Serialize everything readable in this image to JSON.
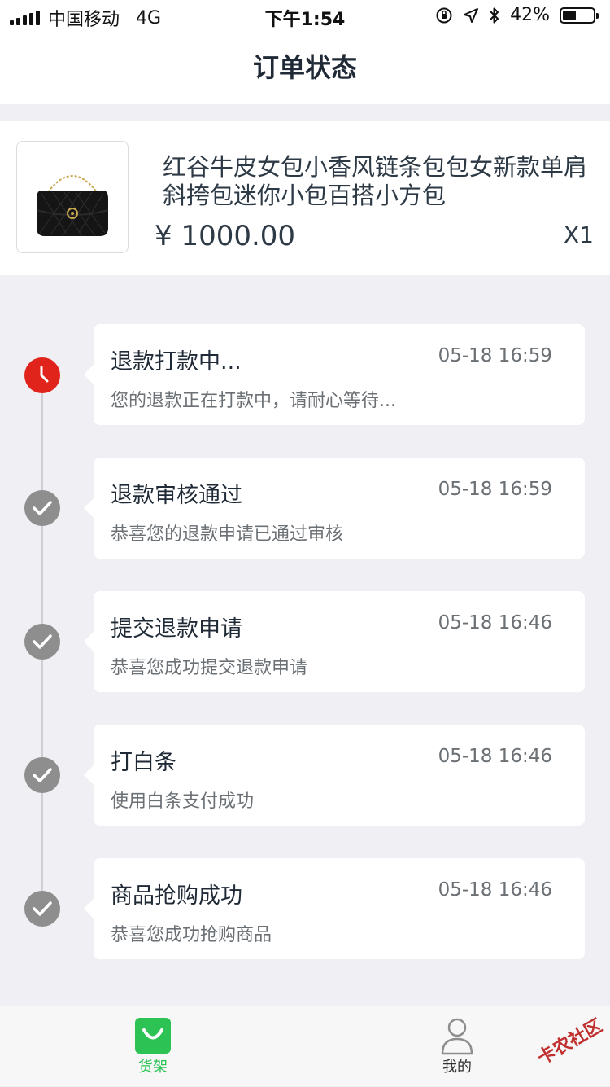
{
  "status_bar": {
    "carrier": "中国移动",
    "network": "4G",
    "time": "下午1:54",
    "battery": "42%",
    "battery_level": 0.42
  },
  "nav": {
    "title": "订单状态"
  },
  "product": {
    "title": "红谷牛皮女包小香风链条包包女新款单肩斜挎包迷你小包百搭小方包",
    "price": "¥ 1000.00",
    "quantity": "X1"
  },
  "timeline": [
    {
      "title": "退款打款中...",
      "time": "05-18 16:59",
      "desc": "您的退款正在打款中，请耐心等待...",
      "state": "active"
    },
    {
      "title": "退款审核通过",
      "time": "05-18 16:59",
      "desc": "恭喜您的退款申请已通过审核",
      "state": "done"
    },
    {
      "title": "提交退款申请",
      "time": "05-18 16:46",
      "desc": "恭喜您成功提交退款申请",
      "state": "done"
    },
    {
      "title": "打白条",
      "time": "05-18 16:46",
      "desc": "使用白条支付成功",
      "state": "done"
    },
    {
      "title": "商品抢购成功",
      "time": "05-18 16:46",
      "desc": "恭喜您成功抢购商品",
      "state": "done"
    }
  ],
  "tabbar": {
    "items": [
      {
        "label": "货架",
        "icon": "shopping-bag-icon",
        "active": true
      },
      {
        "label": "我的",
        "icon": "user-icon",
        "active": false
      }
    ]
  },
  "watermark": "卡农社区",
  "colors": {
    "accent_green": "#2cc354",
    "active_red": "#e0241c",
    "done_gray": "#8e8e8e"
  }
}
